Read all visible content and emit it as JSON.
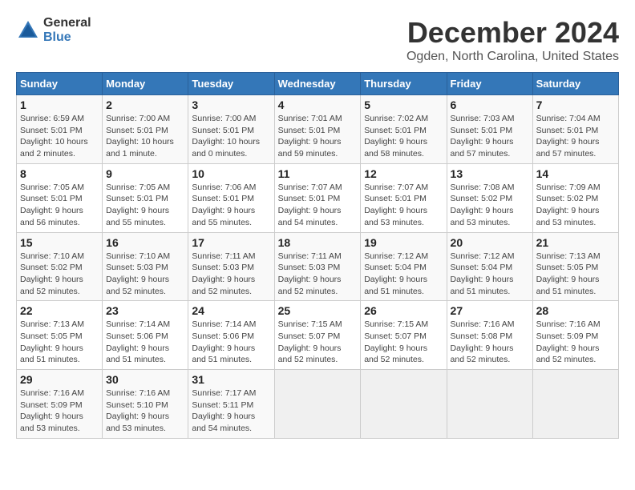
{
  "header": {
    "logo_line1": "General",
    "logo_line2": "Blue",
    "month": "December 2024",
    "location": "Ogden, North Carolina, United States"
  },
  "days_of_week": [
    "Sunday",
    "Monday",
    "Tuesday",
    "Wednesday",
    "Thursday",
    "Friday",
    "Saturday"
  ],
  "weeks": [
    [
      {
        "num": "1",
        "sunrise": "6:59 AM",
        "sunset": "5:01 PM",
        "daylight": "10 hours and 2 minutes."
      },
      {
        "num": "2",
        "sunrise": "7:00 AM",
        "sunset": "5:01 PM",
        "daylight": "10 hours and 1 minute."
      },
      {
        "num": "3",
        "sunrise": "7:00 AM",
        "sunset": "5:01 PM",
        "daylight": "10 hours and 0 minutes."
      },
      {
        "num": "4",
        "sunrise": "7:01 AM",
        "sunset": "5:01 PM",
        "daylight": "9 hours and 59 minutes."
      },
      {
        "num": "5",
        "sunrise": "7:02 AM",
        "sunset": "5:01 PM",
        "daylight": "9 hours and 58 minutes."
      },
      {
        "num": "6",
        "sunrise": "7:03 AM",
        "sunset": "5:01 PM",
        "daylight": "9 hours and 57 minutes."
      },
      {
        "num": "7",
        "sunrise": "7:04 AM",
        "sunset": "5:01 PM",
        "daylight": "9 hours and 57 minutes."
      }
    ],
    [
      {
        "num": "8",
        "sunrise": "7:05 AM",
        "sunset": "5:01 PM",
        "daylight": "9 hours and 56 minutes."
      },
      {
        "num": "9",
        "sunrise": "7:05 AM",
        "sunset": "5:01 PM",
        "daylight": "9 hours and 55 minutes."
      },
      {
        "num": "10",
        "sunrise": "7:06 AM",
        "sunset": "5:01 PM",
        "daylight": "9 hours and 55 minutes."
      },
      {
        "num": "11",
        "sunrise": "7:07 AM",
        "sunset": "5:01 PM",
        "daylight": "9 hours and 54 minutes."
      },
      {
        "num": "12",
        "sunrise": "7:07 AM",
        "sunset": "5:01 PM",
        "daylight": "9 hours and 53 minutes."
      },
      {
        "num": "13",
        "sunrise": "7:08 AM",
        "sunset": "5:02 PM",
        "daylight": "9 hours and 53 minutes."
      },
      {
        "num": "14",
        "sunrise": "7:09 AM",
        "sunset": "5:02 PM",
        "daylight": "9 hours and 53 minutes."
      }
    ],
    [
      {
        "num": "15",
        "sunrise": "7:10 AM",
        "sunset": "5:02 PM",
        "daylight": "9 hours and 52 minutes."
      },
      {
        "num": "16",
        "sunrise": "7:10 AM",
        "sunset": "5:03 PM",
        "daylight": "9 hours and 52 minutes."
      },
      {
        "num": "17",
        "sunrise": "7:11 AM",
        "sunset": "5:03 PM",
        "daylight": "9 hours and 52 minutes."
      },
      {
        "num": "18",
        "sunrise": "7:11 AM",
        "sunset": "5:03 PM",
        "daylight": "9 hours and 52 minutes."
      },
      {
        "num": "19",
        "sunrise": "7:12 AM",
        "sunset": "5:04 PM",
        "daylight": "9 hours and 51 minutes."
      },
      {
        "num": "20",
        "sunrise": "7:12 AM",
        "sunset": "5:04 PM",
        "daylight": "9 hours and 51 minutes."
      },
      {
        "num": "21",
        "sunrise": "7:13 AM",
        "sunset": "5:05 PM",
        "daylight": "9 hours and 51 minutes."
      }
    ],
    [
      {
        "num": "22",
        "sunrise": "7:13 AM",
        "sunset": "5:05 PM",
        "daylight": "9 hours and 51 minutes."
      },
      {
        "num": "23",
        "sunrise": "7:14 AM",
        "sunset": "5:06 PM",
        "daylight": "9 hours and 51 minutes."
      },
      {
        "num": "24",
        "sunrise": "7:14 AM",
        "sunset": "5:06 PM",
        "daylight": "9 hours and 51 minutes."
      },
      {
        "num": "25",
        "sunrise": "7:15 AM",
        "sunset": "5:07 PM",
        "daylight": "9 hours and 52 minutes."
      },
      {
        "num": "26",
        "sunrise": "7:15 AM",
        "sunset": "5:07 PM",
        "daylight": "9 hours and 52 minutes."
      },
      {
        "num": "27",
        "sunrise": "7:16 AM",
        "sunset": "5:08 PM",
        "daylight": "9 hours and 52 minutes."
      },
      {
        "num": "28",
        "sunrise": "7:16 AM",
        "sunset": "5:09 PM",
        "daylight": "9 hours and 52 minutes."
      }
    ],
    [
      {
        "num": "29",
        "sunrise": "7:16 AM",
        "sunset": "5:09 PM",
        "daylight": "9 hours and 53 minutes."
      },
      {
        "num": "30",
        "sunrise": "7:16 AM",
        "sunset": "5:10 PM",
        "daylight": "9 hours and 53 minutes."
      },
      {
        "num": "31",
        "sunrise": "7:17 AM",
        "sunset": "5:11 PM",
        "daylight": "9 hours and 54 minutes."
      },
      null,
      null,
      null,
      null
    ]
  ]
}
